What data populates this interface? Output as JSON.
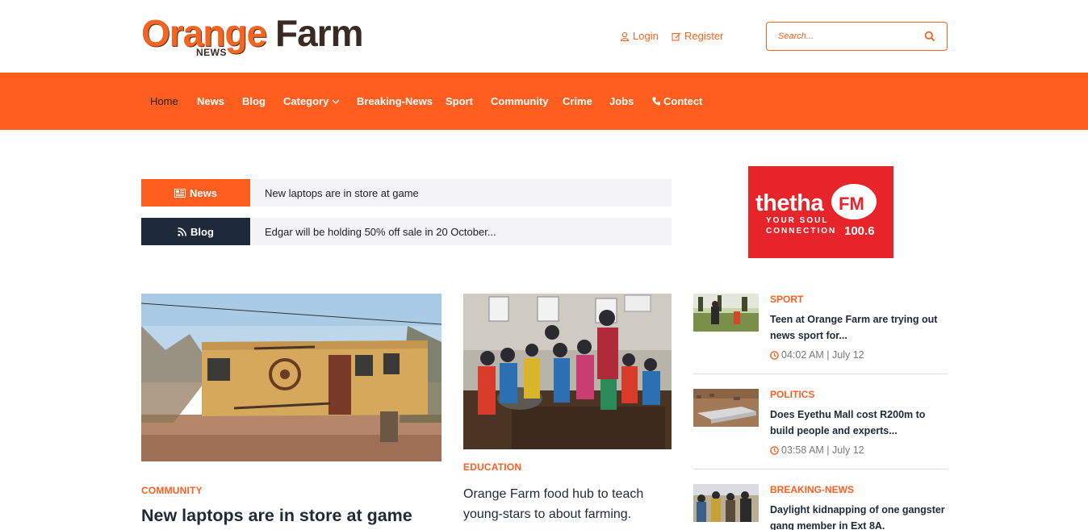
{
  "header": {
    "logo": {
      "orange": "Orange",
      "farm": "Farm",
      "news": "NEWS"
    },
    "login_label": "Login",
    "register_label": "Register",
    "search_placeholder": "Search..."
  },
  "nav": {
    "items": [
      {
        "label": "Home"
      },
      {
        "label": "News"
      },
      {
        "label": "Blog"
      },
      {
        "label": "Category"
      },
      {
        "label": "Breaking-News"
      },
      {
        "label": "Sport"
      },
      {
        "label": "Community"
      },
      {
        "label": "Crime"
      },
      {
        "label": "Jobs"
      },
      {
        "label": "Contect"
      }
    ]
  },
  "ticker": {
    "news": {
      "tag": "News",
      "text": "New laptops are in store at game"
    },
    "blog": {
      "tag": "Blog",
      "text": "Edgar will be holding 50% off sale in 20 October..."
    }
  },
  "ad": {
    "brand": "thetha",
    "fm": "FM",
    "slogan_line1": "YOUR SOUL",
    "slogan_line2": "CONNECTION",
    "freq": "100.6"
  },
  "featured": [
    {
      "category": "COMMUNITY",
      "title": "New laptops are in store at game"
    },
    {
      "category": "EDUCATION",
      "title_line1": "Orange Farm food hub to teach",
      "title_line2": "young-stars to about farming."
    }
  ],
  "side": [
    {
      "category": "SPORT",
      "title": "Teen at Orange Farm are trying out news sport for...",
      "time": "04:02 AM | July 12"
    },
    {
      "category": "POLITICS",
      "title": "Does Eyethu Mall cost R200m to build people and experts...",
      "time": "03:58 AM | July 12"
    },
    {
      "category": "BREAKING-NEWS",
      "title": "Daylight kidnapping of one gangster gang member in Ext 8A."
    }
  ],
  "colors": {
    "accent": "#ff5e1f",
    "dark": "#1e2a3a",
    "ad_red": "#e8242b"
  },
  "icons": {
    "login": "user-icon",
    "register": "edit-icon",
    "search": "search-icon",
    "category": "chevron-down-icon",
    "contect": "phone-icon",
    "news_tag": "newspaper-icon",
    "blog_tag": "rss-icon",
    "time": "clock-icon"
  }
}
